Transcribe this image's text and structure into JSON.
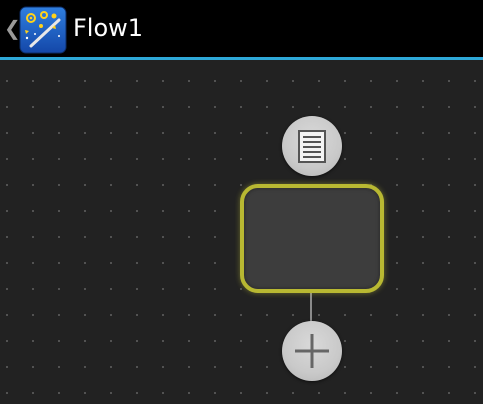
{
  "action_bar": {
    "title": "Flow1",
    "up_glyph": "❮",
    "app_icon": "flow-app-icon",
    "divider_color": "#2ea8d8"
  },
  "canvas": {
    "background_color": "#222222",
    "grid_dot_color": "#5a5a5a",
    "node": {
      "border_color": "#b8b832",
      "fill_color": "#3d3d3d"
    },
    "top_button_icon": "document-list-icon",
    "bottom_button_icon": "plus-icon"
  }
}
